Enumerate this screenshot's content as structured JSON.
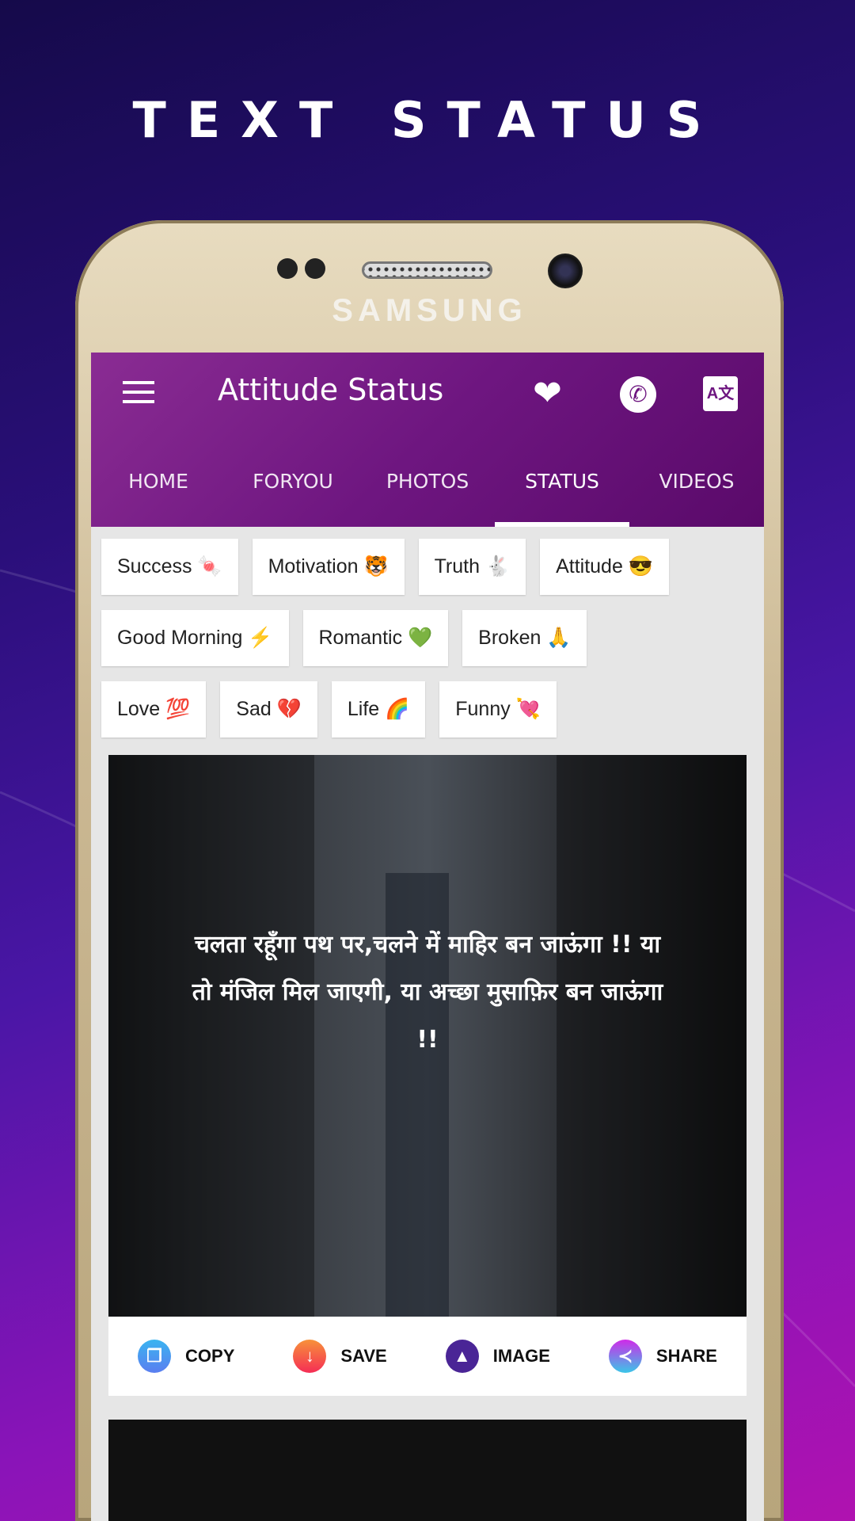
{
  "headline": "TEXT STATUS",
  "phone": {
    "brand": "SAMSUNG"
  },
  "appbar": {
    "title": "Attitude Status",
    "icons": [
      "menu-icon",
      "heart-icon",
      "whatsapp-icon",
      "translate-icon"
    ]
  },
  "tabs": [
    {
      "label": "HOME"
    },
    {
      "label": "FORYOU"
    },
    {
      "label": "PHOTOS"
    },
    {
      "label": "STATUS",
      "active": true
    },
    {
      "label": "VIDEOS"
    }
  ],
  "categories": [
    [
      "Success 🍬",
      "Motivation 🐯",
      "Truth 🐇",
      "Attitude 😎"
    ],
    [
      "Good Morning ⚡",
      "Romantic 💚",
      "Broken 🙏"
    ],
    [
      "Love 💯",
      "Sad 💔",
      "Life 🌈",
      "Funny 💘"
    ]
  ],
  "card": {
    "quote": "चलता रहूँगा पथ पर,चलने में माहिर बन जाऊंगा !! या तो मंजिल मिल जाएगी, या अच्छा मुसाफ़िर बन जाऊंगा !!"
  },
  "actions": [
    {
      "label": "COPY",
      "icon": "copy-icon",
      "color": "#3a8ef0"
    },
    {
      "label": "SAVE",
      "icon": "download-icon",
      "color": "#f5573a"
    },
    {
      "label": "IMAGE",
      "icon": "image-icon",
      "color": "#4a2596"
    },
    {
      "label": "SHARE",
      "icon": "share-icon",
      "color": "#b03ae8"
    }
  ],
  "colors": {
    "appbar": "#6e1680",
    "accent": "#ffffff"
  }
}
